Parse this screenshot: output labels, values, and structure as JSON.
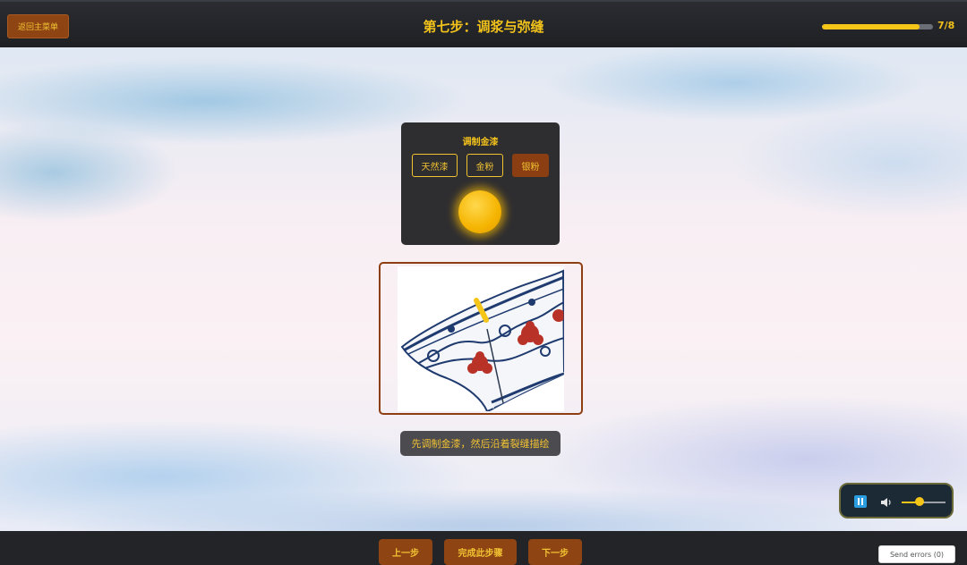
{
  "header": {
    "back_label": "返回主菜单",
    "title": "第七步：调浆与弥缝",
    "progress_text": "7/8",
    "progress_fraction": 0.875
  },
  "mix_panel": {
    "title": "调制金漆",
    "ingredients": [
      {
        "label": "天然漆",
        "selected": false
      },
      {
        "label": "金粉",
        "selected": false
      },
      {
        "label": "银粉",
        "selected": true
      }
    ],
    "mixture_color": "#f5b400"
  },
  "hint": "先调制金漆，然后沿着裂缝描绘",
  "player": {
    "state_icon": "pause-icon",
    "volume_icon": "speaker-icon",
    "volume_fraction": 0.4
  },
  "footer": {
    "prev_label": "上一步",
    "complete_label": "完成此步骤",
    "next_label": "下一步",
    "send_errors_label": "Send errors (0)"
  },
  "colors": {
    "accent_gold": "#f2c21b",
    "button_brown": "#8e4513",
    "bar_dark": "#222428"
  }
}
